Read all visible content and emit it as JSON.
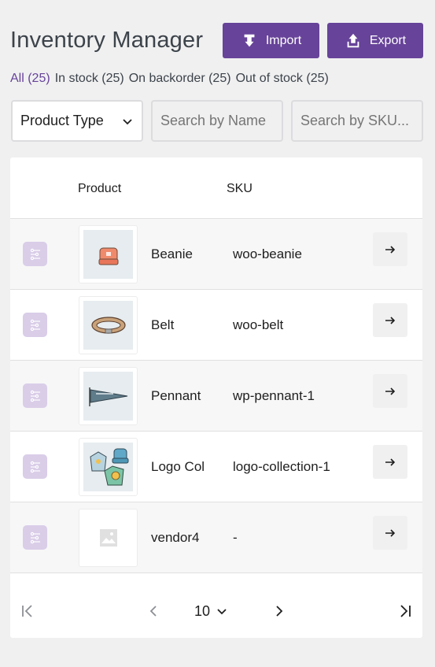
{
  "header": {
    "title": "Inventory Manager",
    "import_label": "Import",
    "export_label": "Export"
  },
  "filters": [
    {
      "label": "All (25)",
      "active": true
    },
    {
      "label": "In stock (25)",
      "active": false
    },
    {
      "label": "On backorder (25)",
      "active": false
    },
    {
      "label": "Out of stock (25)",
      "active": false
    }
  ],
  "controls": {
    "product_type_label": "Product Type",
    "search_name_placeholder": "Search by Name",
    "search_sku_placeholder": "Search by SKU..."
  },
  "table": {
    "columns": [
      "Product",
      "SKU"
    ],
    "rows": [
      {
        "name": "Beanie",
        "sku": "woo-beanie",
        "image": "beanie-image"
      },
      {
        "name": "Belt",
        "sku": "woo-belt",
        "image": "belt-image"
      },
      {
        "name": "Pennant",
        "sku": "wp-pennant-1",
        "image": "pennant-image"
      },
      {
        "name": "Logo Col",
        "sku": "logo-collection-1",
        "image": "logo-collection-image"
      },
      {
        "name": "vendor4",
        "sku": "-",
        "image": "placeholder-image"
      }
    ]
  },
  "pagination": {
    "per_page": "10"
  },
  "colors": {
    "accent": "#674399",
    "variant_badge": "#d9cde8"
  }
}
